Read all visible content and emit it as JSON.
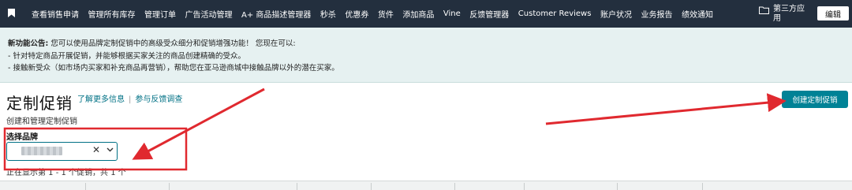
{
  "nav": {
    "bookmark_icon": "bookmark-icon",
    "items": [
      {
        "label": "查看销售申请"
      },
      {
        "label": "管理所有库存"
      },
      {
        "label": "管理订单"
      },
      {
        "label": "广告活动管理"
      },
      {
        "label": "A+ 商品描述管理器"
      },
      {
        "label": "秒杀"
      },
      {
        "label": "优惠券"
      },
      {
        "label": "货件"
      },
      {
        "label": "添加商品"
      },
      {
        "label": "Vine"
      },
      {
        "label": "反馈管理器"
      },
      {
        "label": "Customer Reviews"
      },
      {
        "label": "账户状况"
      },
      {
        "label": "业务报告"
      },
      {
        "label": "绩效通知"
      }
    ],
    "seller_label": "第三方应用",
    "folder_icon": "folder-icon",
    "edit_label": "编辑",
    "bg_color": "#232f3e"
  },
  "announcement": {
    "title": "新功能公告:",
    "line1": " 您可以使用品牌定制促销中的高级受众细分和促销增强功能！ 您现在可以:",
    "line2": "- 针对特定商品开展促销，并能够根据买家关注的商品创建精确的受众。",
    "line3": "- 接触新受众（如市场内买家和补充商品再营销），帮助您在亚马逊商城中接触品牌以外的潜在买家。",
    "bg_color": "#e6f1f1"
  },
  "header": {
    "title": "定制促销",
    "learn_more": "了解更多信息",
    "feedback": "参与反馈调查",
    "subtitle": "创建和管理定制促销",
    "create_button": "创建定制促销",
    "accent_color": "#008296"
  },
  "filter": {
    "brand_label": "选择品牌",
    "clear_icon": "close-icon",
    "chevron_icon": "chevron-down-icon"
  },
  "results": {
    "showing_text": "正在显示第 1 - 1 个促销，共 1 个"
  },
  "annotation": {
    "color": "#e0292f"
  }
}
